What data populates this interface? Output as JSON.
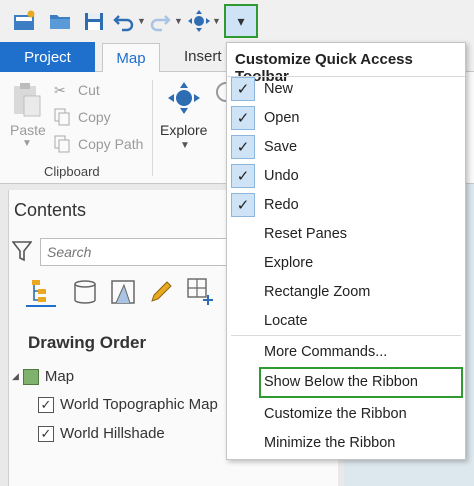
{
  "quick_access": {
    "icons": [
      "new-icon",
      "open-icon",
      "save-icon",
      "undo-icon",
      "redo-icon",
      "explore-icon",
      "customize-dropdown-icon"
    ],
    "customize_glyph": "▾",
    "accent": "#2e9a30"
  },
  "tabs": {
    "project": "Project",
    "map": "Map",
    "insert": "Insert"
  },
  "ribbon": {
    "paste": "Paste",
    "cut": "Cut",
    "copy": "Copy",
    "copy_path": "Copy Path",
    "clipboard_group": "Clipboard",
    "explore": "Explore"
  },
  "contents": {
    "title": "Contents",
    "search_placeholder": "Search",
    "drawing_order": "Drawing Order",
    "map_item": "Map",
    "layers": [
      {
        "label": "World Topographic Map",
        "checked": true
      },
      {
        "label": "World Hillshade",
        "checked": true
      }
    ]
  },
  "menu": {
    "title": "Customize Quick Access Toolbar",
    "check_glyph": "✓",
    "items": [
      {
        "label": "New",
        "checked": true
      },
      {
        "label": "Open",
        "checked": true
      },
      {
        "label": "Save",
        "checked": true
      },
      {
        "label": "Undo",
        "checked": true
      },
      {
        "label": "Redo",
        "checked": true
      },
      {
        "label": "Reset Panes",
        "checked": false
      },
      {
        "label": "Explore",
        "checked": false
      },
      {
        "label": "Rectangle Zoom",
        "checked": false
      },
      {
        "label": "Locate",
        "checked": false
      },
      {
        "label": "More Commands...",
        "checked": false
      },
      {
        "label": "Show Below the Ribbon",
        "checked": false
      },
      {
        "label": "Customize the Ribbon",
        "checked": false
      },
      {
        "label": "Minimize the Ribbon",
        "checked": false
      }
    ]
  },
  "colors": {
    "project_tab": "#1f6fcc",
    "checked_bg": "#cfe3f6",
    "highlight_border": "#2e9a30"
  }
}
